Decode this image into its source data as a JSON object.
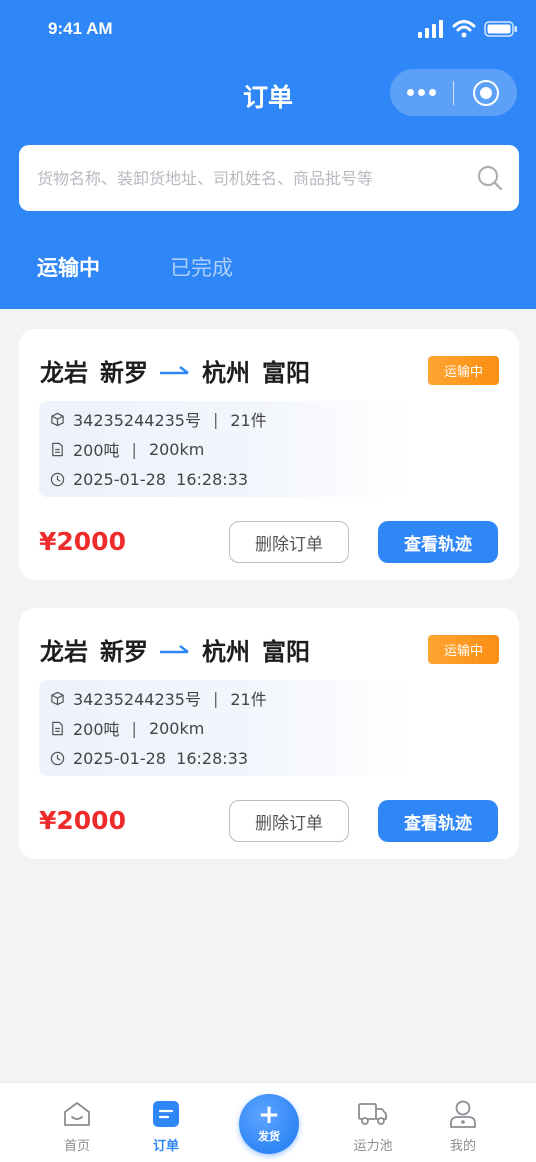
{
  "status_bar": {
    "time": "9:41 AM"
  },
  "nav": {
    "title": "订单"
  },
  "search": {
    "placeholder": "货物名称、装卸货地址、司机姓名、商品批号等"
  },
  "tabs": [
    {
      "label": "运输中",
      "active": true
    },
    {
      "label": "已完成",
      "active": false
    }
  ],
  "orders": [
    {
      "origin_city": "龙岩",
      "origin_district": "新罗",
      "dest_city": "杭州",
      "dest_district": "富阳",
      "status": "运输中",
      "order_no": "34235244235号",
      "pieces": "21件",
      "weight": "200吨",
      "distance": "200km",
      "time": "2025-01-28  16:28:33",
      "price": "¥2000",
      "delete_label": "删除订单",
      "track_label": "查看轨迹"
    },
    {
      "origin_city": "龙岩",
      "origin_district": "新罗",
      "dest_city": "杭州",
      "dest_district": "富阳",
      "status": "运输中",
      "order_no": "34235244235号",
      "pieces": "21件",
      "weight": "200吨",
      "distance": "200km",
      "time": "2025-01-28  16:28:33",
      "price": "¥2000",
      "delete_label": "删除订单",
      "track_label": "查看轨迹"
    }
  ],
  "tabbar": {
    "items": [
      {
        "label": "首页",
        "icon": "home-icon",
        "active": false
      },
      {
        "label": "订单",
        "icon": "order-icon",
        "active": true
      },
      {
        "label": "发货",
        "icon": "plus-icon",
        "active": false
      },
      {
        "label": "运力池",
        "icon": "truck-icon",
        "active": false
      },
      {
        "label": "我的",
        "icon": "user-icon",
        "active": false
      }
    ]
  },
  "colors": {
    "primary": "#2f86f6",
    "price": "#ee2c2c",
    "badge": "#fb8e14",
    "background": "#f2f3f5"
  }
}
